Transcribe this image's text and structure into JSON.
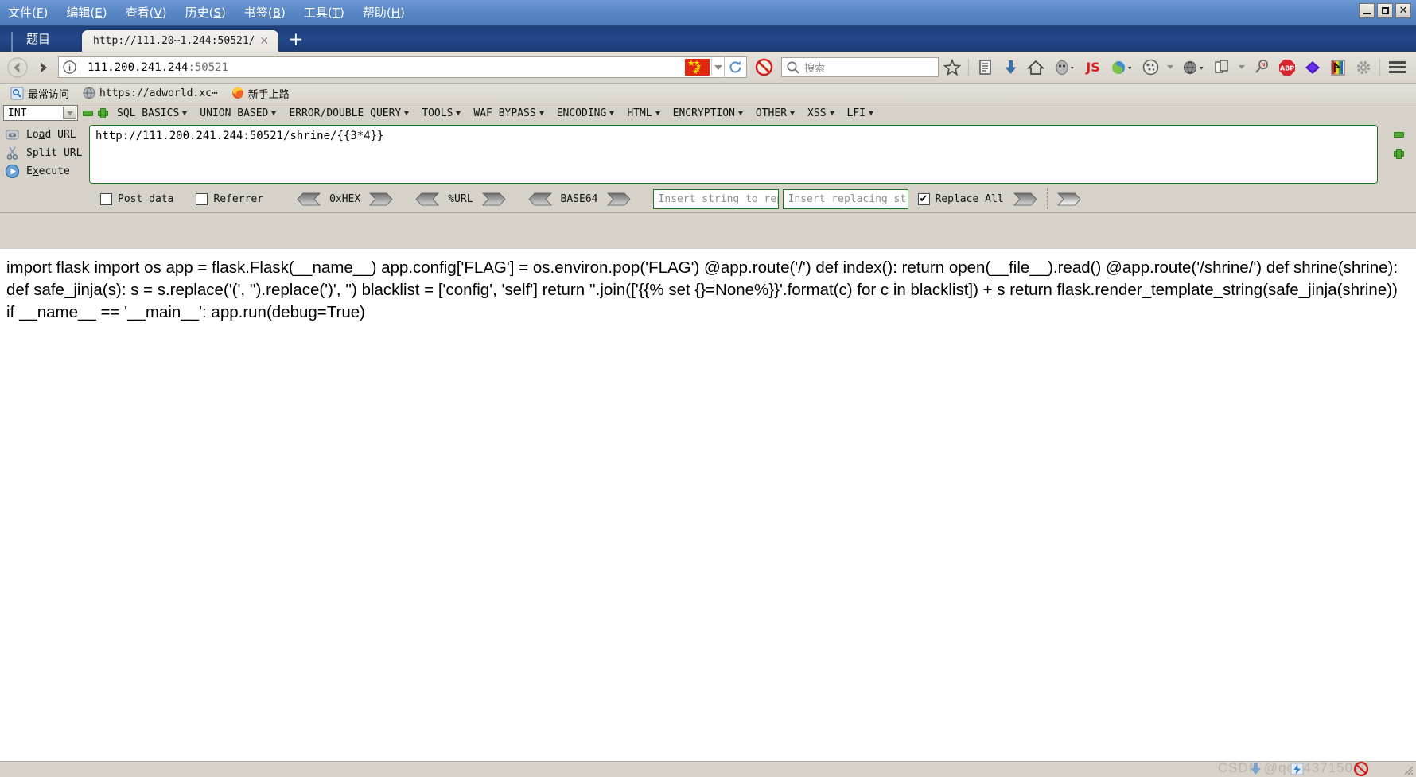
{
  "window": {
    "minimize_label": "_",
    "maximize_label": "□",
    "close_label": "✕"
  },
  "menubar": {
    "items": [
      {
        "text": "文件",
        "mnemonic": "F"
      },
      {
        "text": "编辑",
        "mnemonic": "E"
      },
      {
        "text": "查看",
        "mnemonic": "V"
      },
      {
        "text": "历史",
        "mnemonic": "S"
      },
      {
        "text": "书签",
        "mnemonic": "B"
      },
      {
        "text": "工具",
        "mnemonic": "T"
      },
      {
        "text": "帮助",
        "mnemonic": "H"
      }
    ]
  },
  "tabstrip": {
    "app_label": "题目",
    "tab_title": "http://111.20⋯1.244:50521/",
    "tab_close_label": "✕",
    "new_tab_label": "✚"
  },
  "navbar": {
    "url_host": "111.200.241.244",
    "url_port": ":50521",
    "search_placeholder": "搜索",
    "js_label": "JS",
    "abp_label": "ABP"
  },
  "bookmarks": {
    "items": [
      {
        "label": "最常访问",
        "mono": false,
        "icon": "most-visited-icon"
      },
      {
        "label": "https://adworld.xc⋯",
        "mono": true,
        "icon": "globe-icon"
      },
      {
        "label": "新手上路",
        "mono": false,
        "icon": "firefox-icon"
      }
    ]
  },
  "hackbar": {
    "select_value": "INT",
    "menus": [
      "SQL BASICS",
      "UNION BASED",
      "ERROR/DOUBLE QUERY",
      "TOOLS",
      "WAF BYPASS",
      "ENCODING",
      "HTML",
      "ENCRYPTION",
      "OTHER",
      "XSS",
      "LFI"
    ],
    "actions": [
      {
        "label_pre": "Lo",
        "label_key": "a",
        "label_post": "d URL",
        "icon": "load-url-icon"
      },
      {
        "label_pre": "",
        "label_key": "S",
        "label_post": "plit URL",
        "icon": "split-url-icon"
      },
      {
        "label_pre": "E",
        "label_key": "x",
        "label_post": "ecute",
        "icon": "execute-icon"
      }
    ],
    "url_value": "http://111.200.241.244:50521/shrine/{{3*4}}",
    "post_data_label": "Post data",
    "post_data_checked": false,
    "referrer_label": "Referrer",
    "referrer_checked": false,
    "encoders": [
      "0xHEX",
      "%URL",
      "BASE64"
    ],
    "replace_from_placeholder": "Insert string to replace",
    "replace_to_placeholder": "Insert replacing string",
    "replace_all_label": "Replace All",
    "replace_all_checked": true,
    "checkmark": "✔"
  },
  "page": {
    "body_text": "import flask import os app = flask.Flask(__name__) app.config['FLAG'] = os.environ.pop('FLAG') @app.route('/') def index(): return open(__file__).read() @app.route('/shrine/') def shrine(shrine): def safe_jinja(s): s = s.replace('(', '').replace(')', '') blacklist = ['config', 'self'] return ''.join(['{{% set {}=None%}}'.format(c) for c in blacklist]) + s return flask.render_template_string(safe_jinja(shrine)) if __name__ == '__main__': app.run(debug=True)"
  },
  "status": {
    "watermark": "CSDN @qq_43715020"
  }
}
